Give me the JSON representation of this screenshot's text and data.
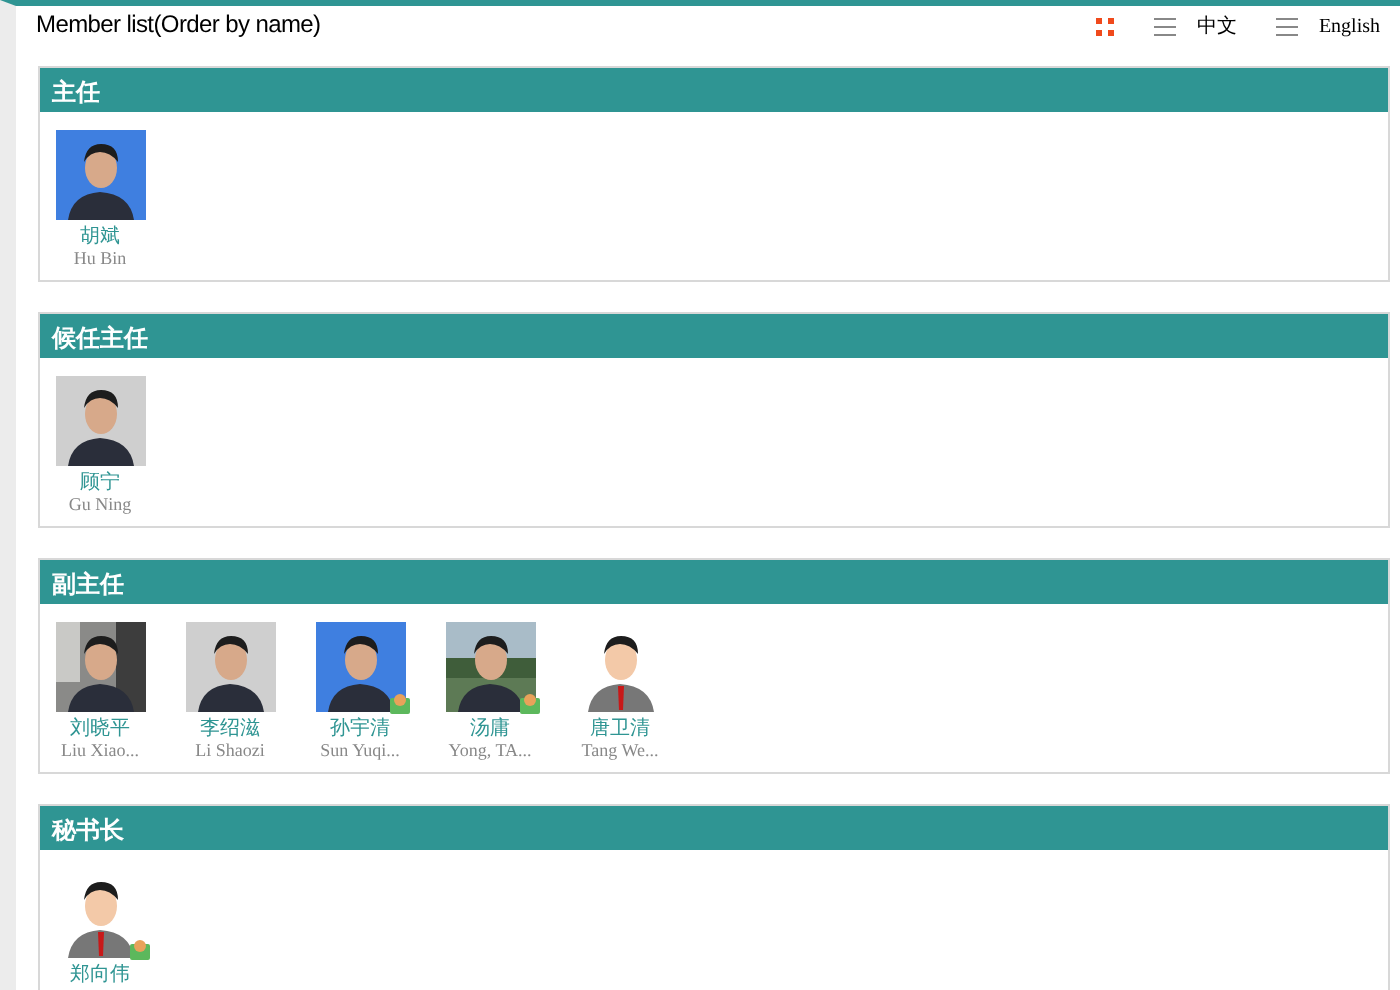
{
  "header": {
    "title": "Member list(Order by name)",
    "languages": [
      "中文",
      "English"
    ]
  },
  "sections": [
    {
      "title": "主任",
      "members": [
        {
          "name": "胡斌",
          "english": "Hu Bin",
          "badge": false
        }
      ]
    },
    {
      "title": "候任主任",
      "members": [
        {
          "name": "顾宁",
          "english": "Gu Ning",
          "badge": false
        }
      ]
    },
    {
      "title": "副主任",
      "members": [
        {
          "name": "刘晓平",
          "english": "Liu Xiao...",
          "badge": false
        },
        {
          "name": "李绍滋",
          "english": "Li Shaozi",
          "badge": false
        },
        {
          "name": "孙宇清",
          "english": "Sun Yuqi...",
          "badge": true
        },
        {
          "name": "汤庸",
          "english": "Yong, TA...",
          "badge": true
        },
        {
          "name": "唐卫清",
          "english": "Tang We...",
          "badge": false
        }
      ]
    },
    {
      "title": "秘书长",
      "members": [
        {
          "name": "郑向伟",
          "badge": true
        }
      ]
    }
  ]
}
